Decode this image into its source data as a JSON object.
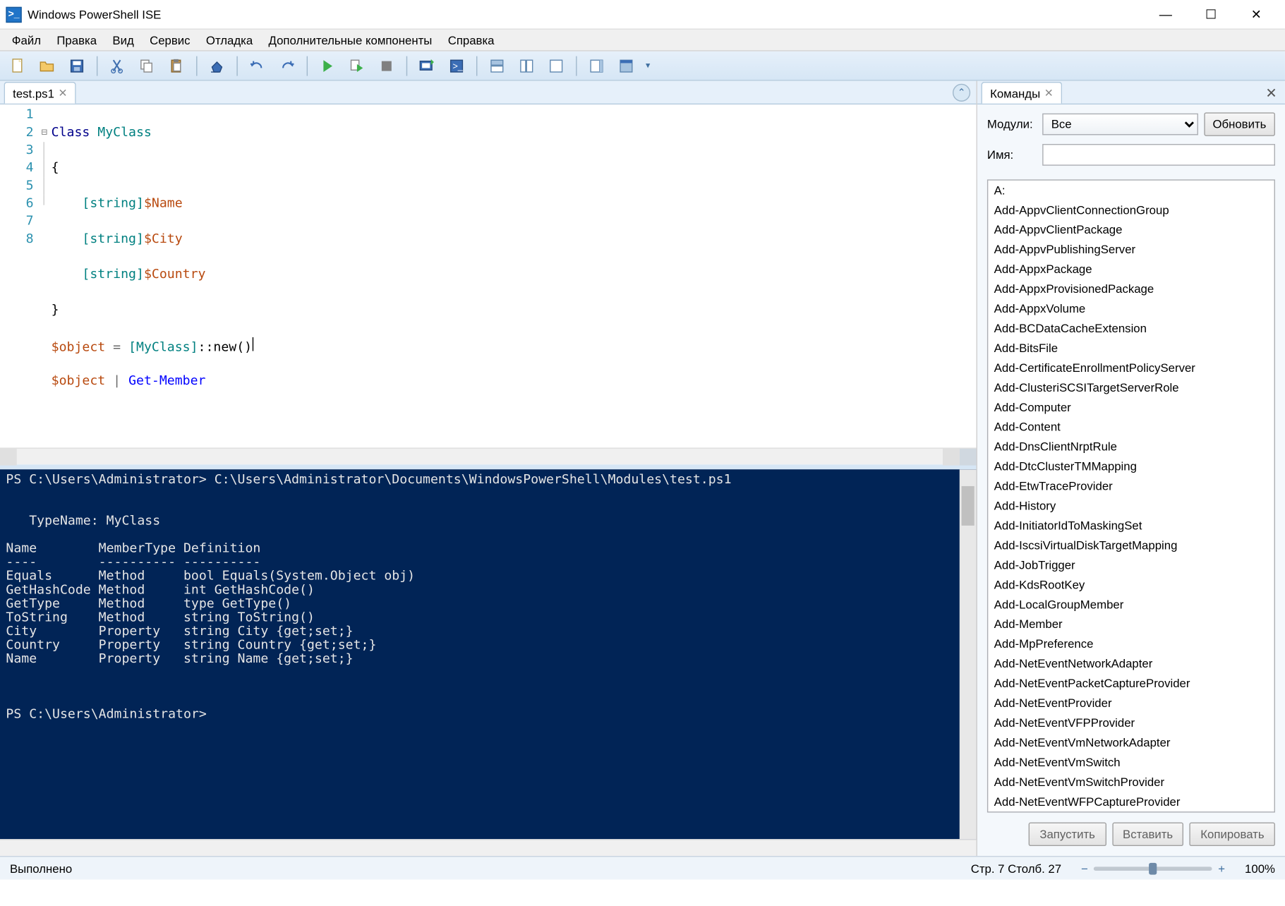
{
  "window": {
    "title": "Windows PowerShell ISE"
  },
  "menu": {
    "file": "Файл",
    "edit": "Правка",
    "view": "Вид",
    "tools": "Сервис",
    "debug": "Отладка",
    "addons": "Дополнительные компоненты",
    "help": "Справка"
  },
  "tabs": {
    "script": "test.ps1"
  },
  "code": {
    "lines": [
      {
        "n": "1"
      },
      {
        "n": "2"
      },
      {
        "n": "3"
      },
      {
        "n": "4"
      },
      {
        "n": "5"
      },
      {
        "n": "6"
      },
      {
        "n": "7"
      },
      {
        "n": "8"
      }
    ],
    "l1_kw": "Class",
    "l1_name": "MyClass",
    "l2_brace": "{",
    "l3_type": "[string]",
    "l3_var": "$Name",
    "l4_type": "[string]",
    "l4_var": "$City",
    "l5_type": "[string]",
    "l5_var": "$Country",
    "l6_brace": "}",
    "l7_var": "$object",
    "l7_eq": " = ",
    "l7_cast": "[MyClass]",
    "l7_new": "::new",
    "l7_paren": "()",
    "l8_var": "$object",
    "l8_pipe": " | ",
    "l8_cmd": "Get-Member"
  },
  "console": {
    "text": "PS C:\\Users\\Administrator> C:\\Users\\Administrator\\Documents\\WindowsPowerShell\\Modules\\test.ps1\n\n\n   TypeName: MyClass\n\nName        MemberType Definition\n----        ---------- ----------\nEquals      Method     bool Equals(System.Object obj)\nGetHashCode Method     int GetHashCode()\nGetType     Method     type GetType()\nToString    Method     string ToString()\nCity        Property   string City {get;set;}\nCountry     Property   string Country {get;set;}\nName        Property   string Name {get;set;}\n\n\n\nPS C:\\Users\\Administrator> "
  },
  "commands_pane": {
    "tab_label": "Команды",
    "modules_label": "Модули:",
    "modules_value": "Все",
    "refresh": "Обновить",
    "name_label": "Имя:",
    "name_value": "",
    "run": "Запустить",
    "insert": "Вставить",
    "copy": "Копировать",
    "items": [
      "A:",
      "Add-AppvClientConnectionGroup",
      "Add-AppvClientPackage",
      "Add-AppvPublishingServer",
      "Add-AppxPackage",
      "Add-AppxProvisionedPackage",
      "Add-AppxVolume",
      "Add-BCDataCacheExtension",
      "Add-BitsFile",
      "Add-CertificateEnrollmentPolicyServer",
      "Add-ClusteriSCSITargetServerRole",
      "Add-Computer",
      "Add-Content",
      "Add-DnsClientNrptRule",
      "Add-DtcClusterTMMapping",
      "Add-EtwTraceProvider",
      "Add-History",
      "Add-InitiatorIdToMaskingSet",
      "Add-IscsiVirtualDiskTargetMapping",
      "Add-JobTrigger",
      "Add-KdsRootKey",
      "Add-LocalGroupMember",
      "Add-Member",
      "Add-MpPreference",
      "Add-NetEventNetworkAdapter",
      "Add-NetEventPacketCaptureProvider",
      "Add-NetEventProvider",
      "Add-NetEventVFPProvider",
      "Add-NetEventVmNetworkAdapter",
      "Add-NetEventVmSwitch",
      "Add-NetEventVmSwitchProvider",
      "Add-NetEventWFPCaptureProvider"
    ]
  },
  "status": {
    "left": "Выполнено",
    "pos": "Стр. 7 Столб. 27",
    "zoom": "100%"
  }
}
